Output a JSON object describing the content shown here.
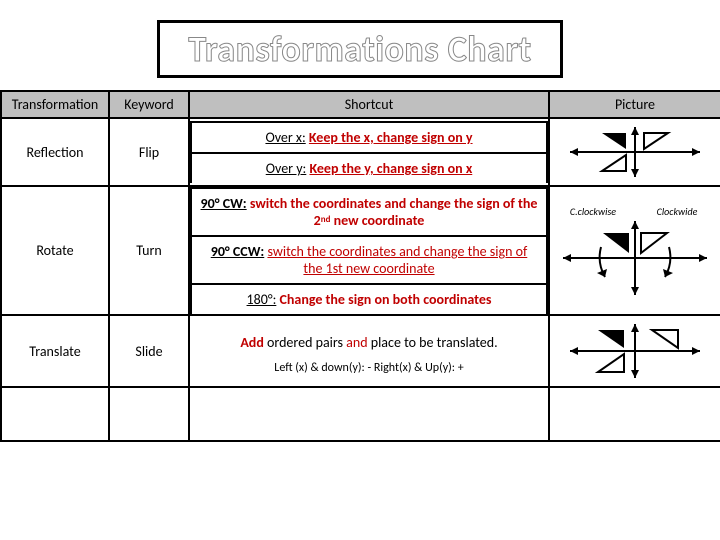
{
  "title": "Transformations Chart",
  "headers": {
    "transformation": "Transformation",
    "keyword": "Keyword",
    "shortcut": "Shortcut",
    "picture": "Picture"
  },
  "rows": {
    "reflection": {
      "name": "Reflection",
      "keyword": "Flip",
      "shortcuts": {
        "over_x_label": "Over x:",
        "over_x_rule": "Keep the x, change sign on y",
        "over_y_label": "Over y:",
        "over_y_rule": "Keep the y, change sign on x"
      }
    },
    "rotate": {
      "name": "Rotate",
      "keyword": "Turn",
      "shortcuts": {
        "cw90_label": "90° CW:",
        "cw90_rule_a": "switch the coordinates and change the sign of the 2",
        "cw90_rule_sup": "nd",
        "cw90_rule_b": " new coordinate",
        "ccw90_label": "90° CCW:",
        "ccw90_rule": "switch the coordinates and change the sign of the 1st new coordinate",
        "r180_label": "180°:",
        "r180_rule": "Change the sign on both coordinates"
      },
      "pic_labels": {
        "ccw": "C.clockwise",
        "cw": "Clockwide"
      }
    },
    "translate": {
      "name": "Translate",
      "keyword": "Slide",
      "shortcuts": {
        "main_a": "Add",
        "main_b": " ordered pairs ",
        "main_c": "and",
        "main_d": " place to be translated.",
        "sub": "Left (x) & down(y): -  Right(x) & Up(y): +"
      }
    }
  }
}
